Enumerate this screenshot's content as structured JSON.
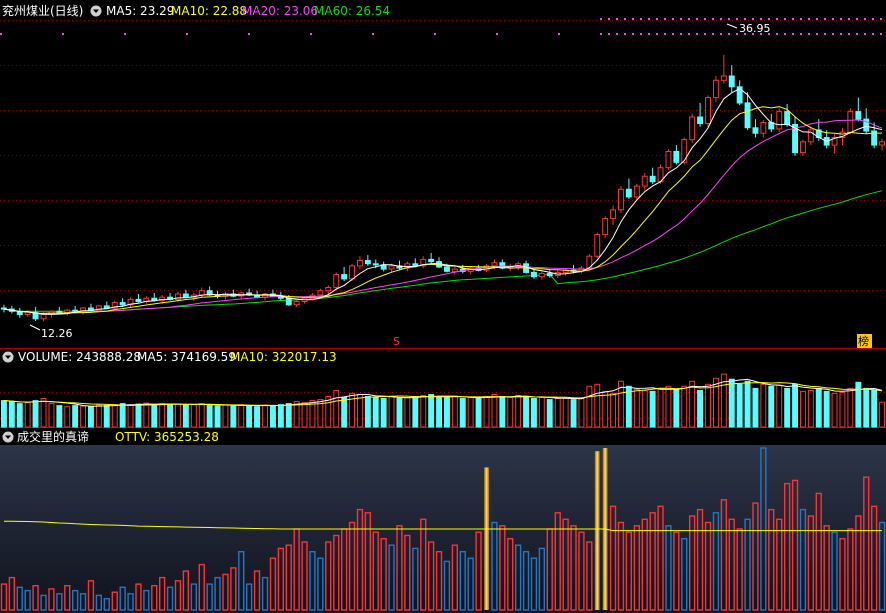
{
  "header": {
    "stock_title": "兖州煤业(日线)",
    "ma5": "MA5: 23.29",
    "ma10": "MA10: 22.88",
    "ma20": "MA20: 23.06",
    "ma60": "MA60: 26.54"
  },
  "volume_header": {
    "volume": "VOLUME: 243888.28",
    "ma5": "MA5: 374169.59",
    "ma10": "MA10: 322017.13"
  },
  "indicator_header": {
    "name": "成交里的真谛",
    "ottv": "OTTV: 365253.28"
  },
  "annotations": {
    "high_price": "36.95",
    "low_price": "12.26",
    "marker_s": "S",
    "marker_bang": "榜"
  },
  "colors": {
    "up": "#ff3232",
    "down": "#54ffff",
    "ma5": "#ffffff",
    "ma10": "#ffff00",
    "ma20": "#ff40ff",
    "ma60": "#00e400",
    "ottv": "#ffff00",
    "blue_bar": "#1e7ac8",
    "gold": "#ffc800"
  },
  "chart_data": [
    {
      "type": "candlestick",
      "panel": "price",
      "ylim": [
        11,
        40
      ],
      "grid": true,
      "bars": [
        [
          13.5,
          13.8,
          13.1,
          13.4
        ],
        [
          13.4,
          13.7,
          13.0,
          13.2
        ],
        [
          13.2,
          13.5,
          12.6,
          12.9
        ],
        [
          12.9,
          13.3,
          12.7,
          13.1
        ],
        [
          13.1,
          13.6,
          12.3,
          12.5
        ],
        [
          12.5,
          13.1,
          12.26,
          12.9
        ],
        [
          12.9,
          13.3,
          12.6,
          13.2
        ],
        [
          13.2,
          13.6,
          12.9,
          13.0
        ],
        [
          13.0,
          13.4,
          12.8,
          13.3
        ],
        [
          13.3,
          13.7,
          13.0,
          13.2
        ],
        [
          13.2,
          13.6,
          12.9,
          13.5
        ],
        [
          13.5,
          13.9,
          13.2,
          13.3
        ],
        [
          13.3,
          13.8,
          13.1,
          13.7
        ],
        [
          13.7,
          14.1,
          13.4,
          13.5
        ],
        [
          13.5,
          14.2,
          13.3,
          14.0
        ],
        [
          14.0,
          14.4,
          13.6,
          13.8
        ],
        [
          13.8,
          14.5,
          13.6,
          14.3
        ],
        [
          14.3,
          14.8,
          14.0,
          14.1
        ],
        [
          14.1,
          14.6,
          13.9,
          14.4
        ],
        [
          14.4,
          14.9,
          14.1,
          14.2
        ],
        [
          14.2,
          14.7,
          13.9,
          14.5
        ],
        [
          14.5,
          14.9,
          14.2,
          14.3
        ],
        [
          14.3,
          15.0,
          14.1,
          14.8
        ],
        [
          14.8,
          15.2,
          14.4,
          14.5
        ],
        [
          14.5,
          14.9,
          14.2,
          14.7
        ],
        [
          14.7,
          15.4,
          14.5,
          15.1
        ],
        [
          15.1,
          15.5,
          14.6,
          14.7
        ],
        [
          14.7,
          15.1,
          14.4,
          14.6
        ],
        [
          14.6,
          15.0,
          14.3,
          14.8
        ],
        [
          14.8,
          15.2,
          14.5,
          14.6
        ],
        [
          14.6,
          15.0,
          14.3,
          14.9
        ],
        [
          14.9,
          15.3,
          14.6,
          14.7
        ],
        [
          14.7,
          15.1,
          14.4,
          14.5
        ],
        [
          14.5,
          14.9,
          14.2,
          14.8
        ],
        [
          14.8,
          15.2,
          14.5,
          14.6
        ],
        [
          14.6,
          15.0,
          14.2,
          14.4
        ],
        [
          14.4,
          14.7,
          13.7,
          13.8
        ],
        [
          13.8,
          14.3,
          13.6,
          14.1
        ],
        [
          14.1,
          14.6,
          13.9,
          14.4
        ],
        [
          14.4,
          14.9,
          14.2,
          14.7
        ],
        [
          14.7,
          15.3,
          14.5,
          15.1
        ],
        [
          15.1,
          15.6,
          14.8,
          15.4
        ],
        [
          15.4,
          16.8,
          15.2,
          16.6
        ],
        [
          16.6,
          17.3,
          16.0,
          16.2
        ],
        [
          16.2,
          17.6,
          16.0,
          17.4
        ],
        [
          17.4,
          18.3,
          17.1,
          17.9
        ],
        [
          17.9,
          18.4,
          17.4,
          17.6
        ],
        [
          17.6,
          18.0,
          17.2,
          17.5
        ],
        [
          17.5,
          17.8,
          16.9,
          17.1
        ],
        [
          17.1,
          17.6,
          16.8,
          17.4
        ],
        [
          17.4,
          17.9,
          17.0,
          17.2
        ],
        [
          17.2,
          17.8,
          16.9,
          17.6
        ],
        [
          17.6,
          18.1,
          17.3,
          17.4
        ],
        [
          17.4,
          18.3,
          17.2,
          18.0
        ],
        [
          18.0,
          18.6,
          17.6,
          17.8
        ],
        [
          17.8,
          18.2,
          17.2,
          17.3
        ],
        [
          17.3,
          17.6,
          16.8,
          16.9
        ],
        [
          16.9,
          17.3,
          16.6,
          17.1
        ],
        [
          17.1,
          17.5,
          16.7,
          16.9
        ],
        [
          16.9,
          17.4,
          16.6,
          17.2
        ],
        [
          17.2,
          17.5,
          16.9,
          17.0
        ],
        [
          17.0,
          17.6,
          16.8,
          17.4
        ],
        [
          17.4,
          18.0,
          17.1,
          17.7
        ],
        [
          17.7,
          18.0,
          17.1,
          17.2
        ],
        [
          17.2,
          17.6,
          16.9,
          17.3
        ],
        [
          17.3,
          17.8,
          17.0,
          17.6
        ],
        [
          17.6,
          17.9,
          16.7,
          16.8
        ],
        [
          16.8,
          17.1,
          16.2,
          16.4
        ],
        [
          16.4,
          16.9,
          16.1,
          16.7
        ],
        [
          16.7,
          17.0,
          16.3,
          16.5
        ],
        [
          16.5,
          17.0,
          16.3,
          16.8
        ],
        [
          16.8,
          17.2,
          16.5,
          17.0
        ],
        [
          17.0,
          17.5,
          16.7,
          16.9
        ],
        [
          16.9,
          17.4,
          16.7,
          17.2
        ],
        [
          17.2,
          18.5,
          17.0,
          18.3
        ],
        [
          18.3,
          20.5,
          18.1,
          20.3
        ],
        [
          20.3,
          22.0,
          20.0,
          21.8
        ],
        [
          21.8,
          23.0,
          21.2,
          22.6
        ],
        [
          22.6,
          24.8,
          22.3,
          24.5
        ],
        [
          24.5,
          25.5,
          23.6,
          23.8
        ],
        [
          23.8,
          25.0,
          23.5,
          24.8
        ],
        [
          24.8,
          26.0,
          24.4,
          25.7
        ],
        [
          25.7,
          26.5,
          25.0,
          25.2
        ],
        [
          25.2,
          26.8,
          25.0,
          26.5
        ],
        [
          26.5,
          28.2,
          26.3,
          28.0
        ],
        [
          28.0,
          28.6,
          26.8,
          27.0
        ],
        [
          27.0,
          29.3,
          26.8,
          29.1
        ],
        [
          29.1,
          31.5,
          28.8,
          31.2
        ],
        [
          31.2,
          32.5,
          30.3,
          30.6
        ],
        [
          30.6,
          33.2,
          30.3,
          33.0
        ],
        [
          33.0,
          35.0,
          32.6,
          34.6
        ],
        [
          34.6,
          36.95,
          34.3,
          35.0
        ],
        [
          35.0,
          36.0,
          33.5,
          34.0
        ],
        [
          34.0,
          34.6,
          32.3,
          32.5
        ],
        [
          32.5,
          33.5,
          30.0,
          30.2
        ],
        [
          30.2,
          31.0,
          29.3,
          29.7
        ],
        [
          29.7,
          30.9,
          29.3,
          30.7
        ],
        [
          30.7,
          31.5,
          29.8,
          30.1
        ],
        [
          30.1,
          32.0,
          29.8,
          31.7
        ],
        [
          31.7,
          32.4,
          30.3,
          30.5
        ],
        [
          30.5,
          31.2,
          27.6,
          27.9
        ],
        [
          27.9,
          29.1,
          27.6,
          28.9
        ],
        [
          28.9,
          30.3,
          28.6,
          30.0
        ],
        [
          30.0,
          31.0,
          29.0,
          29.3
        ],
        [
          29.3,
          30.0,
          28.3,
          28.6
        ],
        [
          28.6,
          29.6,
          27.8,
          29.3
        ],
        [
          29.3,
          30.2,
          28.6,
          29.8
        ],
        [
          29.8,
          32.0,
          29.6,
          31.7
        ],
        [
          31.7,
          33.0,
          30.8,
          31.0
        ],
        [
          31.0,
          32.0,
          29.6,
          29.9
        ],
        [
          29.9,
          30.7,
          28.3,
          28.6
        ],
        [
          28.6,
          29.2,
          28.1,
          28.9
        ]
      ]
    },
    {
      "type": "bar",
      "panel": "volume",
      "ylim": [
        0,
        600000
      ],
      "last_value": 243888.28,
      "values": [
        260000,
        250000,
        230000,
        240000,
        260000,
        280000,
        230000,
        210000,
        200000,
        210000,
        205000,
        200000,
        215000,
        210000,
        220000,
        230000,
        215000,
        225000,
        235000,
        220000,
        230000,
        220000,
        225000,
        215000,
        220000,
        230000,
        210000,
        205000,
        215000,
        205000,
        220000,
        210000,
        200000,
        215000,
        210000,
        220000,
        230000,
        250000,
        240000,
        260000,
        270000,
        300000,
        360000,
        290000,
        330000,
        320000,
        300000,
        290000,
        280000,
        300000,
        280000,
        290000,
        300000,
        310000,
        320000,
        300000,
        290000,
        300000,
        280000,
        290000,
        280000,
        300000,
        320000,
        300000,
        290000,
        310000,
        300000,
        280000,
        290000,
        270000,
        280000,
        290000,
        270000,
        280000,
        400000,
        420000,
        350000,
        330000,
        450000,
        400000,
        370000,
        360000,
        350000,
        380000,
        400000,
        370000,
        400000,
        450000,
        360000,
        420000,
        480000,
        520000,
        470000,
        420000,
        450000,
        380000,
        420000,
        400000,
        410000,
        380000,
        420000,
        350000,
        360000,
        380000,
        350000,
        330000,
        340000,
        380000,
        440000,
        380000,
        360000,
        243888
      ]
    },
    {
      "type": "bar",
      "panel": "indicator",
      "ylim": [
        0,
        1000000
      ],
      "last_value": 365253.28,
      "values": [
        160000,
        200000,
        140000,
        120000,
        150000,
        90000,
        130000,
        100000,
        150000,
        120000,
        100000,
        180000,
        90000,
        70000,
        110000,
        140000,
        100000,
        160000,
        120000,
        150000,
        200000,
        140000,
        180000,
        240000,
        160000,
        280000,
        160000,
        200000,
        220000,
        260000,
        360000,
        160000,
        240000,
        200000,
        320000,
        380000,
        400000,
        500000,
        420000,
        360000,
        320000,
        420000,
        460000,
        500000,
        540000,
        620000,
        600000,
        480000,
        440000,
        400000,
        520000,
        460000,
        380000,
        560000,
        420000,
        360000,
        300000,
        400000,
        360000,
        320000,
        480000,
        880000,
        540000,
        520000,
        440000,
        400000,
        360000,
        320000,
        380000,
        500000,
        600000,
        560000,
        520000,
        480000,
        420000,
        980000,
        1000000,
        640000,
        540000,
        480000,
        520000,
        560000,
        600000,
        640000,
        520000,
        480000,
        440000,
        580000,
        620000,
        540000,
        600000,
        680000,
        560000,
        500000,
        560000,
        660000,
        1000000,
        620000,
        560000,
        780000,
        800000,
        620000,
        580000,
        720000,
        520000,
        480000,
        440000,
        500000,
        580000,
        820000,
        640000,
        540000
      ],
      "bar_colors": [
        "r",
        "r",
        "b",
        "b",
        "r",
        "b",
        "r",
        "b",
        "r",
        "b",
        "b",
        "r",
        "b",
        "b",
        "r",
        "b",
        "b",
        "r",
        "b",
        "r",
        "r",
        "b",
        "r",
        "r",
        "b",
        "r",
        "b",
        "b",
        "r",
        "r",
        "b",
        "b",
        "r",
        "b",
        "r",
        "r",
        "r",
        "r",
        "r",
        "b",
        "b",
        "r",
        "r",
        "r",
        "r",
        "r",
        "r",
        "r",
        "r",
        "b",
        "r",
        "r",
        "b",
        "r",
        "r",
        "r",
        "b",
        "r",
        "b",
        "b",
        "r",
        "g",
        "b",
        "r",
        "r",
        "b",
        "b",
        "b",
        "b",
        "r",
        "r",
        "r",
        "r",
        "r",
        "r",
        "g",
        "g",
        "r",
        "r",
        "r",
        "r",
        "r",
        "r",
        "r",
        "b",
        "r",
        "b",
        "r",
        "r",
        "r",
        "b",
        "r",
        "r",
        "r",
        "b",
        "r",
        "b",
        "r",
        "r",
        "r",
        "r",
        "b",
        "r",
        "r",
        "r",
        "b",
        "r",
        "r",
        "r",
        "r",
        "r",
        "b"
      ],
      "ottv_line": [
        0.188,
        0.188,
        0.187,
        0.186,
        0.185,
        0.183,
        0.18,
        0.177,
        0.175,
        0.172,
        0.17,
        0.168,
        0.166,
        0.165,
        0.164,
        0.162,
        0.16,
        0.158,
        0.157,
        0.156,
        0.155,
        0.154,
        0.153,
        0.152,
        0.151,
        0.15,
        0.149,
        0.148,
        0.147,
        0.146,
        0.145,
        0.144,
        0.143,
        0.142,
        0.141,
        0.14,
        0.14,
        0.14,
        0.14,
        0.14,
        0.14,
        0.14,
        0.14,
        0.14,
        0.14,
        0.14,
        0.14,
        0.14,
        0.14,
        0.14,
        0.14,
        0.14,
        0.14,
        0.14,
        0.14,
        0.14,
        0.14,
        0.14,
        0.14,
        0.14,
        0.14,
        0.14,
        0.14,
        0.14,
        0.14,
        0.14,
        0.14,
        0.14,
        0.14,
        0.14,
        0.14,
        0.14,
        0.14,
        0.14,
        0.14,
        0.14,
        0.14,
        0.13,
        0.13,
        0.13,
        0.13,
        0.13,
        0.13,
        0.13,
        0.13,
        0.13,
        0.13,
        0.13,
        0.13,
        0.13,
        0.13,
        0.13,
        0.13,
        0.13,
        0.13,
        0.13,
        0.13,
        0.13,
        0.13,
        0.13,
        0.13,
        0.13,
        0.13,
        0.13,
        0.13,
        0.13,
        0.13,
        0.13,
        0.13,
        0.13,
        0.13,
        0.13
      ]
    }
  ]
}
